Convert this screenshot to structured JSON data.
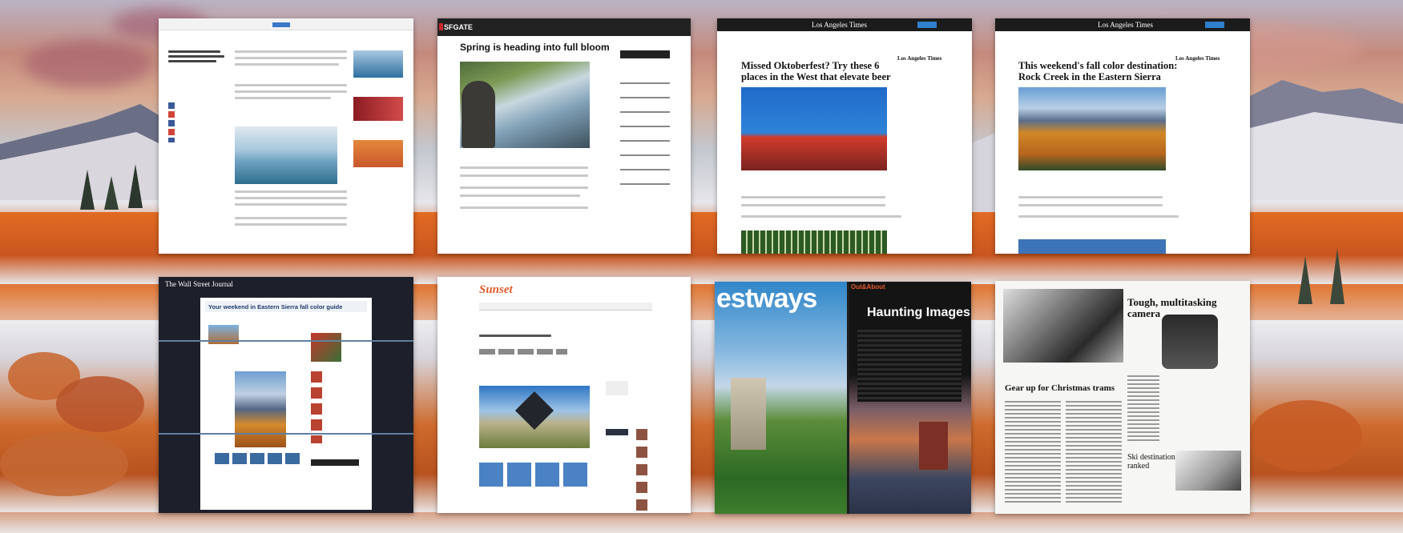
{
  "cards": {
    "sfgate": {
      "logo": "SFGATE",
      "headline": "Spring is heading into full bloom"
    },
    "latimes_1": {
      "masthead": "Los Angeles Times",
      "headline": "Missed Oktoberfest? Try these 6 places in the West that elevate beer",
      "sidebar_label": "Los Angeles Times"
    },
    "latimes_2": {
      "masthead": "Los Angeles Times",
      "headline": "This weekend's fall color destination: Rock Creek in the Eastern Sierra",
      "sidebar_label": "Los Angeles Times"
    },
    "wsj": {
      "masthead": "The Wall Street Journal",
      "banner": "Your weekend in Eastern Sierra fall color guide"
    },
    "sunset": {
      "logo": "Sunset"
    },
    "westways": {
      "logo": "estways",
      "section_label": "Out&About",
      "headline": "Haunting Images"
    },
    "print_paper": {
      "headline_right": "Tough, multitasking camera",
      "headline_left": "Gear up for Christmas trams",
      "sub_headline": "Ski destination ranked"
    }
  },
  "colors": {
    "aspen_orange": "#d8641f",
    "sky_pink": "#c8877a",
    "snow": "#eeeef2",
    "sfgate_red": "#c9282d",
    "sunset_orange": "#e25a2a",
    "westways_blue": "#2f86c9"
  }
}
